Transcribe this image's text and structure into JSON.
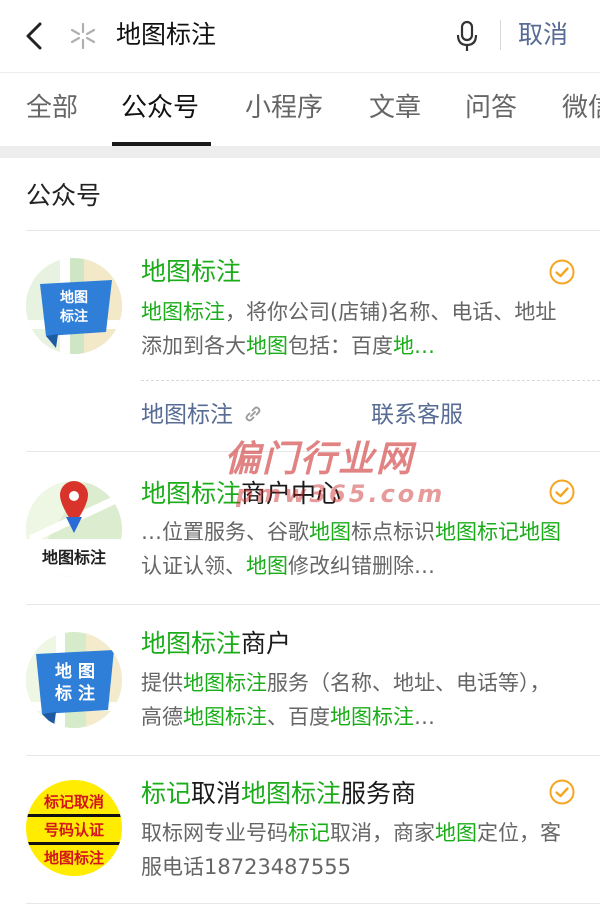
{
  "search": {
    "query": "地图标注",
    "cancel_label": "取消"
  },
  "tabs": [
    {
      "label": "全部"
    },
    {
      "label": "公众号",
      "active": true
    },
    {
      "label": "小程序"
    },
    {
      "label": "文章"
    },
    {
      "label": "问答"
    },
    {
      "label": "微信"
    }
  ],
  "section_title": "公众号",
  "results": [
    {
      "name": [
        {
          "t": "地图标注",
          "hl": true
        }
      ],
      "desc": [
        {
          "t": "地图标注",
          "hl": true
        },
        {
          "t": "，将你公司(店铺)名称、电话、地址添加到各大",
          "hl": false
        },
        {
          "t": "地图",
          "hl": true
        },
        {
          "t": "包括：百度",
          "hl": false
        },
        {
          "t": "地…",
          "hl": true
        }
      ],
      "verified": true,
      "avatar": {
        "line1": "地图",
        "line2": "标注"
      },
      "links": [
        {
          "label": "地图标注",
          "icon": "link-icon"
        },
        {
          "label": "联系客服"
        }
      ]
    },
    {
      "name": [
        {
          "t": "地图标注",
          "hl": true
        },
        {
          "t": "商户中心",
          "hl": false
        }
      ],
      "desc": [
        {
          "t": "…位置服务、谷歌",
          "hl": false
        },
        {
          "t": "地图",
          "hl": true
        },
        {
          "t": "标点标识",
          "hl": false
        },
        {
          "t": "地图标记地图",
          "hl": true
        },
        {
          "t": "认证认领、",
          "hl": false
        },
        {
          "t": "地图",
          "hl": true
        },
        {
          "t": "修改纠错删除…",
          "hl": false
        }
      ],
      "verified": true,
      "avatar": {
        "text": "地图标注"
      }
    },
    {
      "name": [
        {
          "t": "地图标注",
          "hl": true
        },
        {
          "t": "商户",
          "hl": false
        }
      ],
      "desc": [
        {
          "t": "提供",
          "hl": false
        },
        {
          "t": "地图标注",
          "hl": true
        },
        {
          "t": "服务（名称、地址、电话等），高德",
          "hl": false
        },
        {
          "t": "地图标注",
          "hl": true
        },
        {
          "t": "、百度",
          "hl": false
        },
        {
          "t": "地图标注",
          "hl": true
        },
        {
          "t": "…",
          "hl": false
        }
      ],
      "verified": false,
      "avatar": {
        "line1": "地 图",
        "line2": "标 注"
      }
    },
    {
      "name": [
        {
          "t": "标记",
          "hl": true
        },
        {
          "t": "取消",
          "hl": false
        },
        {
          "t": "地图标注",
          "hl": true
        },
        {
          "t": "服务商",
          "hl": false
        }
      ],
      "desc": [
        {
          "t": "取标网专业号码",
          "hl": false
        },
        {
          "t": "标记",
          "hl": true
        },
        {
          "t": "取消，商家",
          "hl": false
        },
        {
          "t": "地图",
          "hl": true
        },
        {
          "t": "定位，客服电话18723487555",
          "hl": false
        }
      ],
      "verified": true,
      "avatar": {
        "line1": "标记取消",
        "line2": "号码认证",
        "line3": "地图标注"
      }
    }
  ],
  "watermark": {
    "line1": "偏门行业网",
    "line2": "pmw365.com"
  },
  "colors": {
    "accent_link": "#576b95",
    "highlight": "#1aad19",
    "verified": "#f5a623"
  }
}
